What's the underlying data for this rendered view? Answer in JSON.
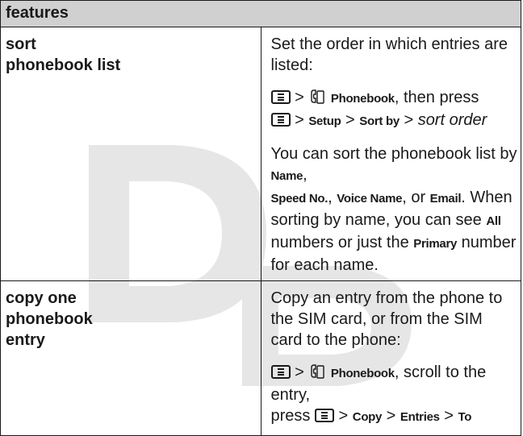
{
  "table": {
    "header": "features",
    "rows": [
      {
        "feature": [
          "sort",
          "phonebook list"
        ],
        "intro": "Set the order in which entries are listed:",
        "path": {
          "l1_sep1": ">",
          "l1_label": "Phonebook",
          "l1_text": ", then press",
          "l2_sep1": ">",
          "l2_setup": "Setup",
          "l2_sep2": ">",
          "l2_sortby": "Sort by",
          "l2_sep3": ">",
          "l2_order": "sort order"
        },
        "body": {
          "t1": "You can sort the phonebook list by ",
          "b1": "Name",
          "t2": ",",
          "b2": "Speed No.",
          "t3": ", ",
          "b3": "Voice Name",
          "t4": ", or ",
          "b4": "Email",
          "t5": ". When sorting by name, you can see ",
          "b5": "All",
          "t6": " numbers or just the ",
          "b6": "Primary",
          "t7": " number for each name."
        }
      },
      {
        "feature": [
          "copy one",
          "phonebook",
          "entry"
        ],
        "intro": "Copy an entry from the phone to the SIM card, or from the SIM card to the phone:",
        "path": {
          "l1_sep1": ">",
          "l1_label": "Phonebook",
          "l1_text": ", scroll to the entry,",
          "l2_press": "press",
          "l2_sep1": ">",
          "l2_copy": "Copy",
          "l2_sep2": ">",
          "l2_entries": "Entries",
          "l2_sep3": ">",
          "l2_to": "To"
        }
      }
    ]
  },
  "icons": {
    "menu_key": "menu-key-icon",
    "phonebook": "phonebook-icon"
  },
  "colors": {
    "header_bg": "#d0d0d0",
    "watermark": "#e6e6e6",
    "text": "#1a1a1a"
  }
}
